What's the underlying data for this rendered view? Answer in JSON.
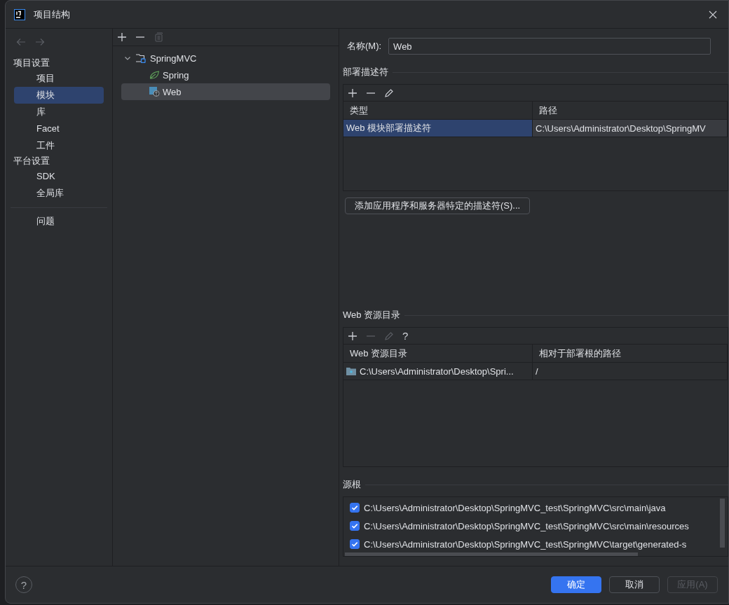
{
  "window": {
    "title": "项目结构"
  },
  "sidebar": {
    "sections": [
      {
        "heading": "项目设置",
        "items": [
          {
            "label": "项目",
            "selected": false
          },
          {
            "label": "模块",
            "selected": true
          },
          {
            "label": "库",
            "selected": false
          },
          {
            "label": "Facet",
            "selected": false
          },
          {
            "label": "工件",
            "selected": false
          }
        ]
      },
      {
        "heading": "平台设置",
        "items": [
          {
            "label": "SDK",
            "selected": false
          },
          {
            "label": "全局库",
            "selected": false
          }
        ]
      }
    ],
    "extra_items": [
      {
        "label": "问题",
        "selected": false
      }
    ]
  },
  "tree": {
    "items": [
      {
        "label": "SpringMVC",
        "kind": "module",
        "expanded": true,
        "selected": false,
        "children": [
          {
            "label": "Spring",
            "kind": "spring",
            "selected": false
          },
          {
            "label": "Web",
            "kind": "web",
            "selected": true
          }
        ]
      }
    ]
  },
  "name_field": {
    "label": "名称(M):",
    "value": "Web"
  },
  "deployment_descriptors": {
    "title": "部署描述符",
    "toolbar": [
      {
        "kind": "add",
        "disabled": false
      },
      {
        "kind": "remove",
        "disabled": false
      },
      {
        "kind": "edit",
        "disabled": false
      }
    ],
    "columns": [
      "类型",
      "路径"
    ],
    "rows": [
      {
        "cells": [
          "Web 模块部署描述符",
          "C:\\Users\\Administrator\\Desktop\\SpringMV"
        ],
        "selected": true
      }
    ],
    "add_button": "添加应用程序和服务器特定的描述符(S)..."
  },
  "web_resources": {
    "title": "Web 资源目录",
    "toolbar": [
      {
        "kind": "add",
        "disabled": false
      },
      {
        "kind": "remove",
        "disabled": true
      },
      {
        "kind": "edit",
        "disabled": true
      },
      {
        "kind": "help",
        "label": "?",
        "disabled": false
      }
    ],
    "columns": [
      "Web 资源目录",
      "相对于部署根的路径"
    ],
    "rows": [
      {
        "cells": [
          "C:\\Users\\Administrator\\Desktop\\Spri...",
          "/"
        ],
        "selected": false
      }
    ]
  },
  "source_roots": {
    "title": "源根",
    "items": [
      {
        "path": "C:\\Users\\Administrator\\Desktop\\SpringMVC_test\\SpringMVC\\src\\main\\java",
        "checked": true
      },
      {
        "path": "C:\\Users\\Administrator\\Desktop\\SpringMVC_test\\SpringMVC\\src\\main\\resources",
        "checked": true
      },
      {
        "path": "C:\\Users\\Administrator\\Desktop\\SpringMVC_test\\SpringMVC\\target\\generated-s",
        "checked": true
      }
    ]
  },
  "footer": {
    "help": "?",
    "buttons": [
      {
        "label": "确定",
        "kind": "primary",
        "disabled": false
      },
      {
        "label": "取消",
        "kind": "normal",
        "disabled": false
      },
      {
        "label": "应用(A)",
        "kind": "normal",
        "disabled": true
      }
    ]
  }
}
